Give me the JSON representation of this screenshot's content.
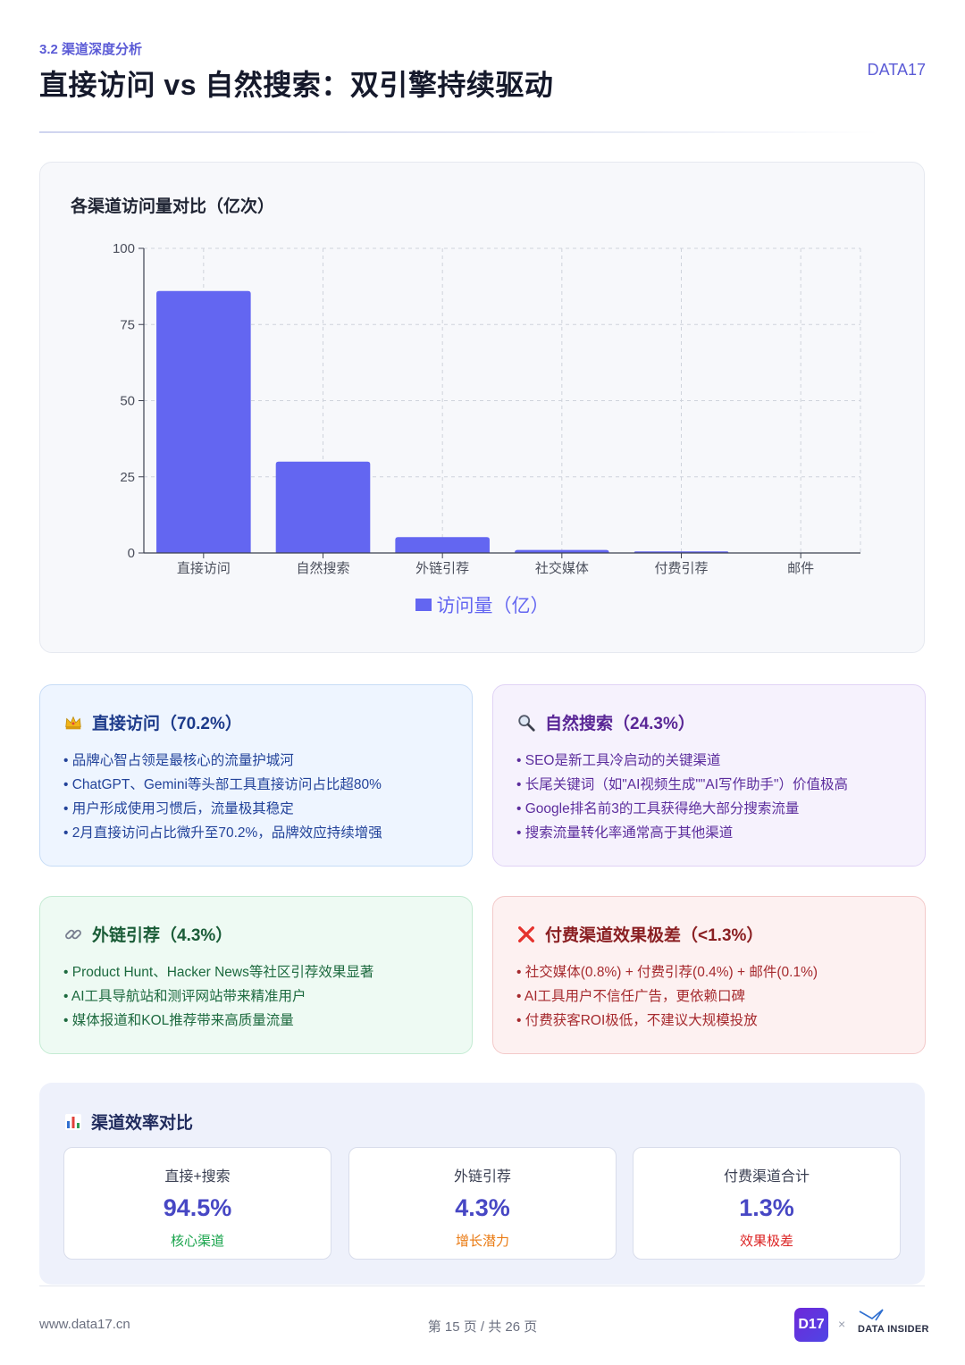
{
  "header": {
    "section": "3.2 渠道深度分析",
    "title": "直接访问 vs 自然搜索：双引擎持续驱动",
    "brand": "DATA17"
  },
  "chart_card": {
    "title": "各渠道访问量对比（亿次）"
  },
  "chart_data": {
    "type": "bar",
    "title": "各渠道访问量对比（亿次）",
    "categories": [
      "直接访问",
      "自然搜索",
      "外链引荐",
      "社交媒体",
      "付费引荐",
      "邮件"
    ],
    "series": [
      {
        "name": "访问量（亿）",
        "values": [
          86,
          30,
          5.2,
          1.0,
          0.5,
          0.1
        ],
        "color": "#6366f1"
      }
    ],
    "ylim": [
      0,
      100
    ],
    "yticks": [
      "0",
      "25",
      "50",
      "75",
      "100"
    ],
    "grid": true,
    "legend": "bottom-center"
  },
  "cards": {
    "direct": {
      "icon": "crown-icon",
      "title": "直接访问（70.2%）",
      "items": [
        "品牌心智占领是最核心的流量护城河",
        "ChatGPT、Gemini等头部工具直接访问占比超80%",
        "用户形成使用习惯后，流量极其稳定",
        "2月直接访问占比微升至70.2%，品牌效应持续增强"
      ]
    },
    "search": {
      "icon": "magnifier-icon",
      "title": "自然搜索（24.3%）",
      "items": [
        "SEO是新工具冷启动的关键渠道",
        "长尾关键词（如\"AI视频生成\"\"AI写作助手\"）价值极高",
        "Google排名前3的工具获得绝大部分搜索流量",
        "搜索流量转化率通常高于其他渠道"
      ]
    },
    "referral": {
      "icon": "link-icon",
      "title": "外链引荐（4.3%）",
      "items": [
        "Product Hunt、Hacker News等社区引荐效果显著",
        "AI工具导航站和测评网站带来精准用户",
        "媒体报道和KOL推荐带来高质量流量"
      ]
    },
    "paid": {
      "icon": "cross-icon",
      "title": "付费渠道效果极差（<1.3%）",
      "items": [
        "社交媒体(0.8%) + 付费引荐(0.4%) + 邮件(0.1%)",
        "AI工具用户不信任广告，更依赖口碑",
        "付费获客ROI极低，不建议大规模投放"
      ]
    }
  },
  "efficiency": {
    "icon": "bar-chart-icon",
    "title": "渠道效率对比",
    "metrics": [
      {
        "label": "直接+搜索",
        "value": "94.5%",
        "note": "核心渠道",
        "note_color": "#16a34a"
      },
      {
        "label": "外链引荐",
        "value": "4.3%",
        "note": "增长潜力",
        "note_color": "#ea7a12"
      },
      {
        "label": "付费渠道合计",
        "value": "1.3%",
        "note": "效果极差",
        "note_color": "#dc2626"
      }
    ]
  },
  "footer": {
    "url": "www.data17.cn",
    "page": "第 15 页 / 共 26 页",
    "logo": "D17",
    "times": "×",
    "partner": "DATA INSIDER"
  }
}
